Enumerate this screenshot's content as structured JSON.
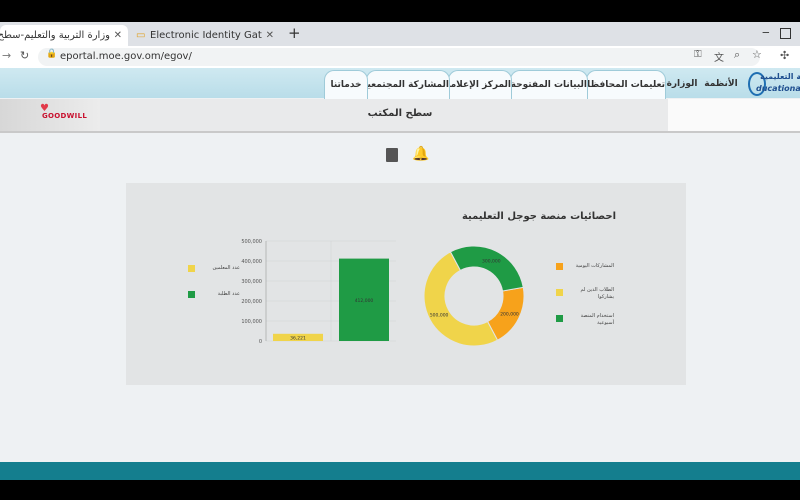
{
  "browser": {
    "tabs": [
      {
        "title": "وزارة التربية والتعليم-سطح المكتب",
        "active": true
      },
      {
        "title": "Electronic Identity Gateway | Aut",
        "active": false
      }
    ],
    "url": "eportal.moe.gov.om/egov/"
  },
  "site": {
    "logo_text": "ية التعليمية",
    "logo_sub": "ducational Po",
    "nav": [
      "الأنظمة",
      "الوزارة",
      "تعليمات المحافظات",
      "البيانات المفتوحة",
      "المركز الإعلامي",
      "المشاركة المجتمعية",
      "خدماتنا"
    ],
    "page_title": "سطح المكتب",
    "goodwill_logo": "GOODWILL"
  },
  "stats": {
    "title": "احصائيات منصة جوجل التعليمية",
    "legend": [
      {
        "label": "المشاركات اليومية",
        "color": "#f7a21b"
      },
      {
        "label": "الطلاب الذين لم يشاركوا",
        "color": "#f0d44a"
      },
      {
        "label": "استخدام المنصة أسبوعية",
        "color": "#1f9b45"
      }
    ],
    "bar_legend": [
      {
        "label": "عدد المعلمين",
        "color": "#f0d44a"
      },
      {
        "label": "عدد الطلبة",
        "color": "#1f9b45"
      }
    ]
  },
  "chart_data": [
    {
      "type": "pie",
      "labels": [
        "المشاركات اليومية",
        "الطلاب الذين لم يشاركوا",
        "استخدام المنصة أسبوعية"
      ],
      "values": [
        200000,
        500000,
        300000
      ],
      "value_labels": [
        "200,000",
        "500,000",
        "300,000"
      ],
      "colors": [
        "#f7a21b",
        "#f0d44a",
        "#1f9b45"
      ]
    },
    {
      "type": "bar",
      "categories": [
        "عدد المعلمين",
        "عدد الطلبة"
      ],
      "values": [
        36000,
        412000
      ],
      "value_labels": [
        "36,221",
        "412,000"
      ],
      "colors": [
        "#f0d44a",
        "#1f9b45"
      ],
      "ylim": [
        0,
        500000
      ],
      "yticks": [
        "0",
        "100,000",
        "200,000",
        "300,000",
        "400,000",
        "500,000"
      ]
    }
  ]
}
